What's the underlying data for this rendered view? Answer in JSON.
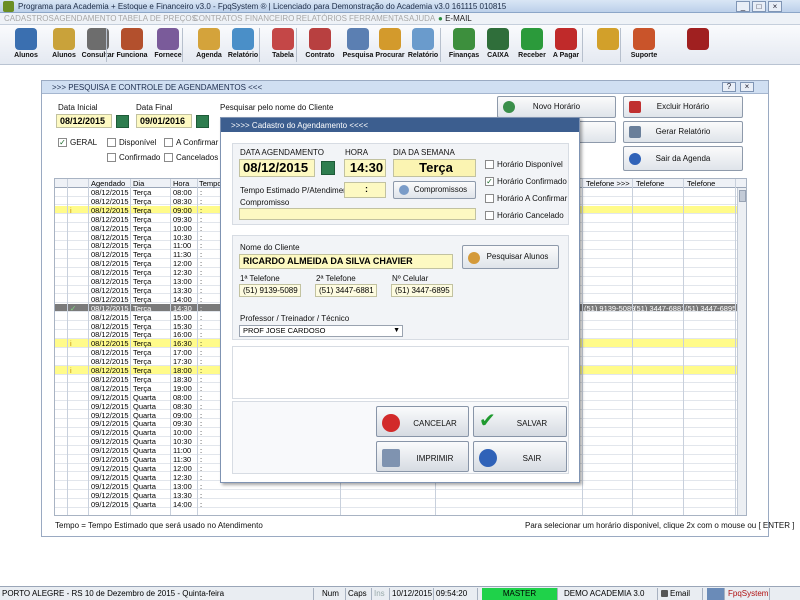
{
  "app": {
    "title": "Programa para Academia + Estoque e Financeiro v3.0 - FpqSystem ® | Licenciado para  Demonstração do Academia v3.0 161115 010815"
  },
  "menu": [
    "CADASTROS",
    "AGENDAMENTO",
    "TABELA DE PREÇOS",
    "CONTRATOS",
    "FINANCEIRO",
    "RELATÓRIOS",
    "FERRAMENTAS",
    "AJUDA",
    "E-MAIL"
  ],
  "toolbar": [
    {
      "label": "Alunos",
      "color": "#3a6fb0"
    },
    {
      "label": "Alunos",
      "color": "#c9a23a"
    },
    {
      "label": "Consultar",
      "color": "#6d6d6d"
    },
    {
      "label": "Funciona",
      "color": "#b3502d"
    },
    {
      "label": "Fornece",
      "color": "#7a5b9a"
    },
    {
      "label": "Agenda",
      "color": "#d4a33b"
    },
    {
      "label": "Relatório",
      "color": "#4a8fc8"
    },
    {
      "label": "Tabela",
      "color": "#c44747"
    },
    {
      "label": "Contrato",
      "color": "#b84040"
    },
    {
      "label": "Pesquisa",
      "color": "#5b7fb2"
    },
    {
      "label": "Procurar",
      "color": "#d39a2c"
    },
    {
      "label": "Relatório",
      "color": "#6a9bcc"
    },
    {
      "label": "Finanças",
      "color": "#3d8f3d"
    },
    {
      "label": "CAIXA",
      "color": "#2f6e3a"
    },
    {
      "label": "Receber",
      "color": "#2b9a3b"
    },
    {
      "label": "A Pagar",
      "color": "#c02a2a"
    },
    {
      "label": "",
      "color": "#d2a02a"
    },
    {
      "label": "Suporte",
      "color": "#c9542a"
    },
    {
      "label": "",
      "color": "#a02020"
    }
  ],
  "main": {
    "title": ">>>  PESQUISA E CONTROLE DE AGENDAMENTOS  <<<",
    "data_inicial_label": "Data Inicial",
    "data_inicial": "08/12/2015",
    "data_final_label": "Data Final",
    "data_final": "09/01/2016",
    "search_label": "Pesquisar pelo nome do Cliente",
    "filters": {
      "geral": "GERAL",
      "disponivel": "Disponível",
      "confirmar": "A Confirmar",
      "confirmado": "Confirmado",
      "cancelados": "Cancelados"
    },
    "buttons": {
      "novo": "Novo Horário",
      "excluir": "Excluir Horário",
      "gerar": "Gerar Relatório",
      "sair": "Sair da Agenda"
    },
    "columns": [
      "Agendado",
      "Dia",
      "Hora",
      "Tempo",
      "Telefone  >>>",
      "Telefone",
      "Telefone"
    ],
    "rows": [
      {
        "d": "08/12/2015",
        "dia": "Terça",
        "h": "08:00",
        "m": "",
        "t": ":"
      },
      {
        "d": "08/12/2015",
        "dia": "Terça",
        "h": "08:30",
        "m": "",
        "t": ":"
      },
      {
        "d": "08/12/2015",
        "dia": "Terça",
        "h": "09:00",
        "m": "i",
        "t": ":"
      },
      {
        "d": "08/12/2015",
        "dia": "Terça",
        "h": "09:30",
        "m": "",
        "t": ":"
      },
      {
        "d": "08/12/2015",
        "dia": "Terça",
        "h": "10:00",
        "m": "",
        "t": ":"
      },
      {
        "d": "08/12/2015",
        "dia": "Terça",
        "h": "10:30",
        "m": "",
        "t": ":"
      },
      {
        "d": "08/12/2015",
        "dia": "Terça",
        "h": "11:00",
        "m": "",
        "t": ":"
      },
      {
        "d": "08/12/2015",
        "dia": "Terça",
        "h": "11:30",
        "m": "",
        "t": ":"
      },
      {
        "d": "08/12/2015",
        "dia": "Terça",
        "h": "12:00",
        "m": "",
        "t": ":"
      },
      {
        "d": "08/12/2015",
        "dia": "Terça",
        "h": "12:30",
        "m": "",
        "t": ":"
      },
      {
        "d": "08/12/2015",
        "dia": "Terça",
        "h": "13:00",
        "m": "",
        "t": ":"
      },
      {
        "d": "08/12/2015",
        "dia": "Terça",
        "h": "13:30",
        "m": "",
        "t": ":"
      },
      {
        "d": "08/12/2015",
        "dia": "Terça",
        "h": "14:00",
        "m": "",
        "t": ":"
      },
      {
        "d": "08/12/2015",
        "dia": "Terça",
        "h": "14:30",
        "m": "✓",
        "t": ":",
        "tel1": "(51) 9139-5089",
        "tel2": "(51) 3447-6881",
        "tel3": "(51) 3447-6895"
      },
      {
        "d": "08/12/2015",
        "dia": "Terça",
        "h": "15:00",
        "m": "",
        "t": ":"
      },
      {
        "d": "08/12/2015",
        "dia": "Terça",
        "h": "15:30",
        "m": "",
        "t": ":"
      },
      {
        "d": "08/12/2015",
        "dia": "Terça",
        "h": "16:00",
        "m": "",
        "t": ":"
      },
      {
        "d": "08/12/2015",
        "dia": "Terça",
        "h": "16:30",
        "m": "i",
        "t": ":"
      },
      {
        "d": "08/12/2015",
        "dia": "Terça",
        "h": "17:00",
        "m": "",
        "t": ":"
      },
      {
        "d": "08/12/2015",
        "dia": "Terça",
        "h": "17:30",
        "m": "",
        "t": ":"
      },
      {
        "d": "08/12/2015",
        "dia": "Terça",
        "h": "18:00",
        "m": "i",
        "t": ":"
      },
      {
        "d": "08/12/2015",
        "dia": "Terça",
        "h": "18:30",
        "m": "",
        "t": ":"
      },
      {
        "d": "08/12/2015",
        "dia": "Terça",
        "h": "19:00",
        "m": "",
        "t": ":"
      },
      {
        "d": "09/12/2015",
        "dia": "Quarta",
        "h": "08:00",
        "m": "",
        "t": ":"
      },
      {
        "d": "09/12/2015",
        "dia": "Quarta",
        "h": "08:30",
        "m": "",
        "t": ":"
      },
      {
        "d": "09/12/2015",
        "dia": "Quarta",
        "h": "09:00",
        "m": "",
        "t": ":"
      },
      {
        "d": "09/12/2015",
        "dia": "Quarta",
        "h": "09:30",
        "m": "",
        "t": ":"
      },
      {
        "d": "09/12/2015",
        "dia": "Quarta",
        "h": "10:00",
        "m": "",
        "t": ":"
      },
      {
        "d": "09/12/2015",
        "dia": "Quarta",
        "h": "10:30",
        "m": "",
        "t": ":"
      },
      {
        "d": "09/12/2015",
        "dia": "Quarta",
        "h": "11:00",
        "m": "",
        "t": ":"
      },
      {
        "d": "09/12/2015",
        "dia": "Quarta",
        "h": "11:30",
        "m": "",
        "t": ":"
      },
      {
        "d": "09/12/2015",
        "dia": "Quarta",
        "h": "12:00",
        "m": "",
        "t": ":"
      },
      {
        "d": "09/12/2015",
        "dia": "Quarta",
        "h": "12:30",
        "m": "",
        "t": ":"
      },
      {
        "d": "09/12/2015",
        "dia": "Quarta",
        "h": "13:00",
        "m": "",
        "t": ":"
      },
      {
        "d": "09/12/2015",
        "dia": "Quarta",
        "h": "13:30",
        "m": "",
        "t": ":"
      },
      {
        "d": "09/12/2015",
        "dia": "Quarta",
        "h": "14:00",
        "m": "",
        "t": ":"
      }
    ],
    "footer_left": "Tempo = Tempo Estimado que será usado no Atendimento",
    "footer_right": "Para selecionar um horário disponivel, clique 2x com o mouse ou [ ENTER ]"
  },
  "dialog": {
    "title": ">>>>  Cadastro do Agendamento  <<<<",
    "data_label": "DATA AGENDAMENTO",
    "data": "08/12/2015",
    "hora_label": "HORA",
    "hora": "14:30",
    "dia_label": "DIA DA SEMANA",
    "dia": "Terça",
    "tempo_label": "Tempo Estimado P/Atendimento",
    "tempo": ":",
    "compromissos_btn": "Compromissos",
    "compromisso_label": "Compromisso",
    "status": {
      "disponivel": "Horário Disponível",
      "confirmado": "Horário Confirmado",
      "confirmar": "Horário A Confirmar",
      "cancelado": "Horário Cancelado"
    },
    "cliente_label": "Nome do Cliente",
    "cliente": "RICARDO ALMEIDA DA SILVA CHAVIER",
    "pesquisar_btn": "Pesquisar Alunos",
    "tel1_label": "1ª Telefone",
    "tel1": "(51) 9139-5089",
    "tel2_label": "2ª Telefone",
    "tel2": "(51) 3447-6881",
    "cel_label": "Nº Celular",
    "cel": "(51) 3447-6895",
    "prof_label": "Professor / Treinador / Técnico",
    "prof": "PROF JOSE CARDOSO",
    "cancelar": "CANCELAR",
    "salvar": "SALVAR",
    "imprimir": "IMPRIMIR",
    "sair": "SAIR"
  },
  "status": {
    "location": "PORTO ALEGRE - RS 10 de Dezembro de 2015 - Quinta-feira",
    "num": "Num",
    "caps": "Caps",
    "ins": "Ins",
    "date": "10/12/2015",
    "time": "09:54:20",
    "master": "MASTER",
    "demo": "DEMO ACADEMIA 3.0",
    "email": "Email",
    "fpq": "FpqSystem"
  },
  "colors": {
    "highlight": "#fffb8a",
    "selected": "#7a7a7a",
    "master": "#1fd24a",
    "accent": "#3c5e8f"
  }
}
